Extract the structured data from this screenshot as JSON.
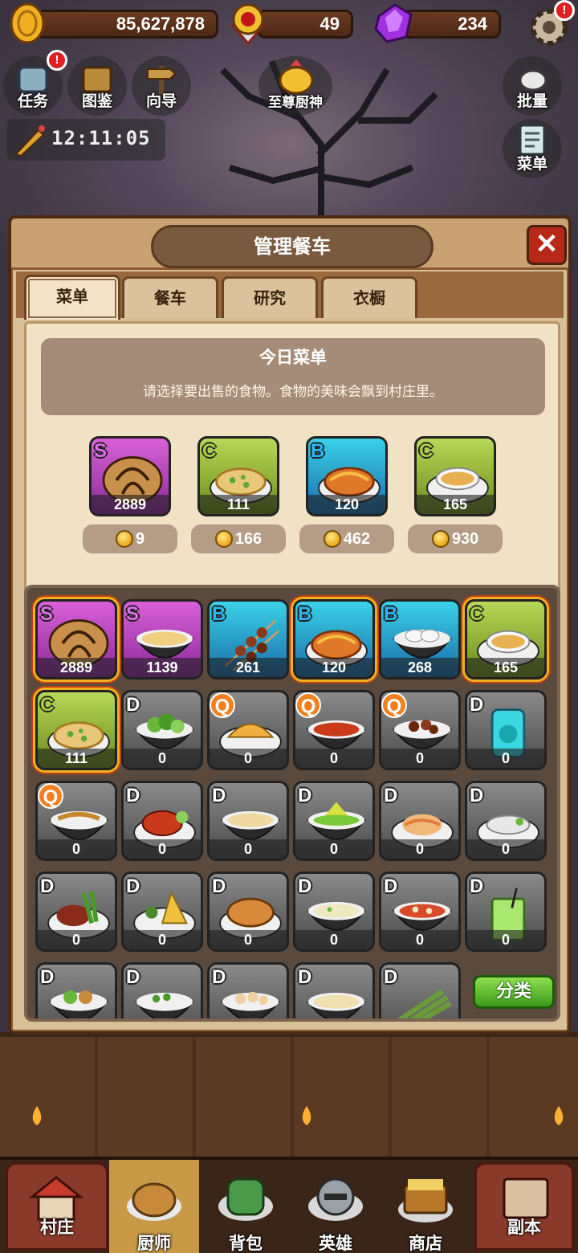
{
  "top_bar": {
    "gold": "85,627,878",
    "medals": "49",
    "gems": "234",
    "settings_badge": "!"
  },
  "top_buttons": {
    "quest_label": "任务",
    "quest_badge": "!",
    "collection_label": "图鉴",
    "guide_label": "向导",
    "chef_god_label": "至尊厨神",
    "batch_label": "批量",
    "menu_label": "菜单"
  },
  "timer": {
    "value": "12:11:05"
  },
  "panel": {
    "title": "管理餐车",
    "close_icon": "close-icon",
    "tabs": [
      {
        "label": "菜单",
        "active": true
      },
      {
        "label": "餐车",
        "active": false
      },
      {
        "label": "研究",
        "active": false
      },
      {
        "label": "衣橱",
        "active": false
      }
    ]
  },
  "today_menu": {
    "title": "今日菜单",
    "description": "请选择要出售的食物。食物的美味会飘到村庄里。",
    "items": [
      {
        "rank": "S",
        "count": "2889",
        "price": "9",
        "icon": "bread"
      },
      {
        "rank": "C",
        "count": "111",
        "price": "166",
        "icon": "pizza"
      },
      {
        "rank": "B",
        "count": "120",
        "price": "462",
        "icon": "shrimp-pie"
      },
      {
        "rank": "C",
        "count": "165",
        "price": "930",
        "icon": "soup-cup"
      }
    ]
  },
  "food_grid": {
    "sort_label": "分类",
    "items": [
      {
        "rank": "S",
        "count": "2889",
        "icon": "bread",
        "glow": true
      },
      {
        "rank": "S",
        "count": "1139",
        "icon": "cream-soup",
        "glow": false
      },
      {
        "rank": "B",
        "count": "261",
        "icon": "skewers",
        "glow": false
      },
      {
        "rank": "B",
        "count": "120",
        "icon": "shrimp-pie",
        "glow": true
      },
      {
        "rank": "B",
        "count": "268",
        "icon": "dumpling-bowl",
        "glow": false
      },
      {
        "rank": "C",
        "count": "165",
        "icon": "soup-cup",
        "glow": true
      },
      {
        "rank": "C",
        "count": "111",
        "icon": "pizza",
        "glow": true
      },
      {
        "rank": "D",
        "count": "0",
        "icon": "salad",
        "glow": false
      },
      {
        "rank": "Q",
        "count": "0",
        "icon": "omelette",
        "glow": false
      },
      {
        "rank": "Q",
        "count": "0",
        "icon": "tomato-soup",
        "glow": false
      },
      {
        "rank": "Q",
        "count": "0",
        "icon": "meat-stew",
        "glow": false
      },
      {
        "rank": "D",
        "count": "0",
        "icon": "blue-drink",
        "glow": false
      },
      {
        "rank": "Q",
        "count": "0",
        "icon": "noodle-bowl",
        "glow": false
      },
      {
        "rank": "D",
        "count": "0",
        "icon": "lobster",
        "glow": false
      },
      {
        "rank": "D",
        "count": "0",
        "icon": "porridge",
        "glow": false
      },
      {
        "rank": "D",
        "count": "0",
        "icon": "green-bowl",
        "glow": false
      },
      {
        "rank": "D",
        "count": "0",
        "icon": "pasta",
        "glow": false
      },
      {
        "rank": "D",
        "count": "0",
        "icon": "fish-plate",
        "glow": false
      },
      {
        "rank": "D",
        "count": "0",
        "icon": "meat-platter",
        "glow": false
      },
      {
        "rank": "D",
        "count": "0",
        "icon": "fried-rice",
        "glow": false
      },
      {
        "rank": "D",
        "count": "0",
        "icon": "pie",
        "glow": false
      },
      {
        "rank": "D",
        "count": "0",
        "icon": "tofu-soup",
        "glow": false
      },
      {
        "rank": "D",
        "count": "0",
        "icon": "red-soup",
        "glow": false
      },
      {
        "rank": "D",
        "count": "0",
        "icon": "green-drink",
        "glow": false
      },
      {
        "rank": "D",
        "count": "",
        "icon": "veg-bowl",
        "glow": false
      },
      {
        "rank": "D",
        "count": "",
        "icon": "pea-bowl",
        "glow": false
      },
      {
        "rank": "D",
        "count": "",
        "icon": "seafood-bowl",
        "glow": false
      },
      {
        "rank": "D",
        "count": "",
        "icon": "cream-bowl",
        "glow": false
      },
      {
        "rank": "D",
        "count": "",
        "icon": "asparagus",
        "glow": false
      }
    ]
  },
  "bottom_nav": {
    "village_label": "村庄",
    "chef_label": "厨师",
    "bag_label": "背包",
    "hero_label": "英雄",
    "shop_label": "商店",
    "dungeon_label": "副本"
  },
  "colors": {
    "panel_bg": "#d9bf98",
    "rank_S": "#d960d8",
    "rank_B": "#3ad2e8",
    "rank_C": "#b8d858",
    "rank_D": "#8a8a8a",
    "sort_button": "#5ab82a",
    "close_button": "#b82818"
  }
}
